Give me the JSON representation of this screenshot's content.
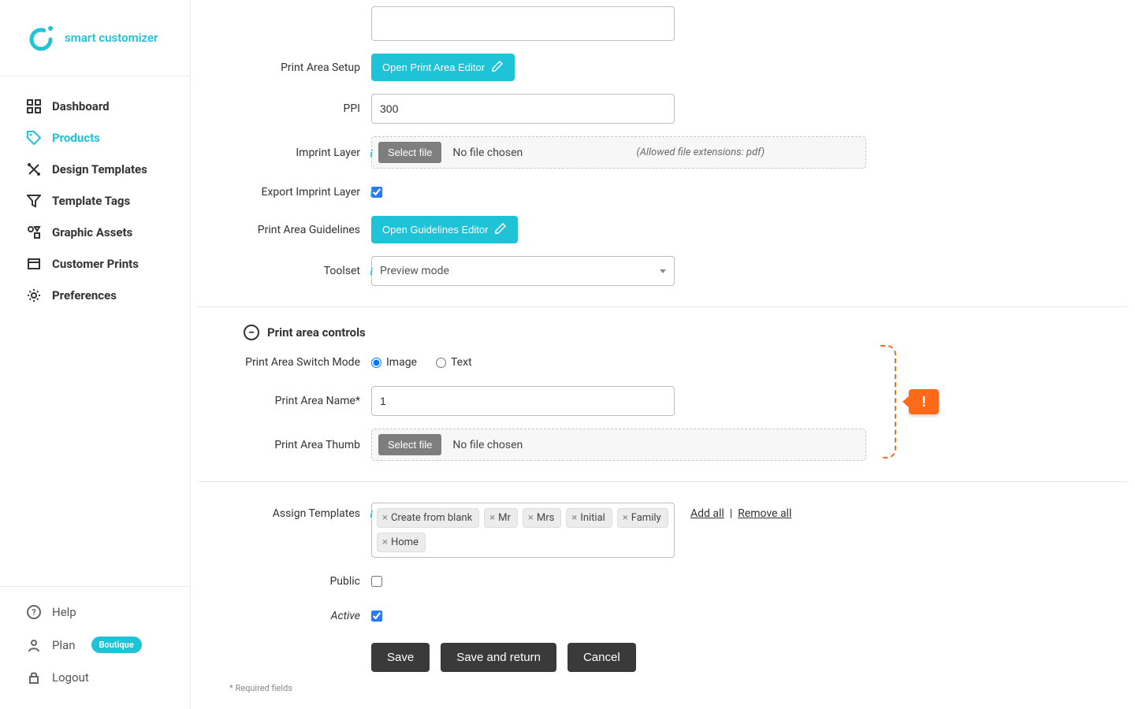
{
  "brand": {
    "name": "smart customizer"
  },
  "sidebar": {
    "items": [
      {
        "label": "Dashboard",
        "icon": "dashboard-icon",
        "active": false
      },
      {
        "label": "Products",
        "icon": "tag-icon",
        "active": true
      },
      {
        "label": "Design Templates",
        "icon": "tools-icon",
        "active": false
      },
      {
        "label": "Template Tags",
        "icon": "filter-icon",
        "active": false
      },
      {
        "label": "Graphic Assets",
        "icon": "assets-icon",
        "active": false
      },
      {
        "label": "Customer Prints",
        "icon": "prints-icon",
        "active": false
      },
      {
        "label": "Preferences",
        "icon": "gear-icon",
        "active": false
      }
    ],
    "bottom": {
      "help": "Help",
      "plan": "Plan",
      "plan_badge": "Boutique",
      "logout": "Logout"
    }
  },
  "form": {
    "print_area_setup": {
      "label": "Print Area Setup",
      "button": "Open Print Area Editor"
    },
    "ppi": {
      "label": "PPI",
      "value": "300"
    },
    "imprint_layer": {
      "label": "Imprint Layer",
      "select_file": "Select file",
      "no_file": "No file chosen",
      "hint": "(Allowed file extensions: pdf)"
    },
    "export_imprint_layer": {
      "label": "Export Imprint Layer",
      "checked": true
    },
    "guidelines": {
      "label": "Print Area Guidelines",
      "button": "Open Guidelines Editor"
    },
    "toolset": {
      "label": "Toolset",
      "value": "Preview mode"
    },
    "section_controls": "Print area controls",
    "switch_mode": {
      "label": "Print Area Switch Mode",
      "options": [
        "Image",
        "Text"
      ],
      "selected": "Image"
    },
    "print_area_name": {
      "label": "Print Area Name*",
      "value": "1"
    },
    "print_area_thumb": {
      "label": "Print Area Thumb",
      "select_file": "Select file",
      "no_file": "No file chosen"
    },
    "assign_templates": {
      "label": "Assign Templates",
      "tags": [
        "Create from blank",
        "Mr",
        "Mrs",
        "Initial",
        "Family",
        "Home"
      ],
      "add_all": "Add all",
      "remove_all": "Remove all"
    },
    "public": {
      "label": "Public",
      "checked": false
    },
    "active": {
      "label": "Active",
      "checked": true
    },
    "actions": {
      "save": "Save",
      "save_return": "Save and return",
      "cancel": "Cancel"
    },
    "required_note": "* Required fields",
    "alert": "!"
  }
}
